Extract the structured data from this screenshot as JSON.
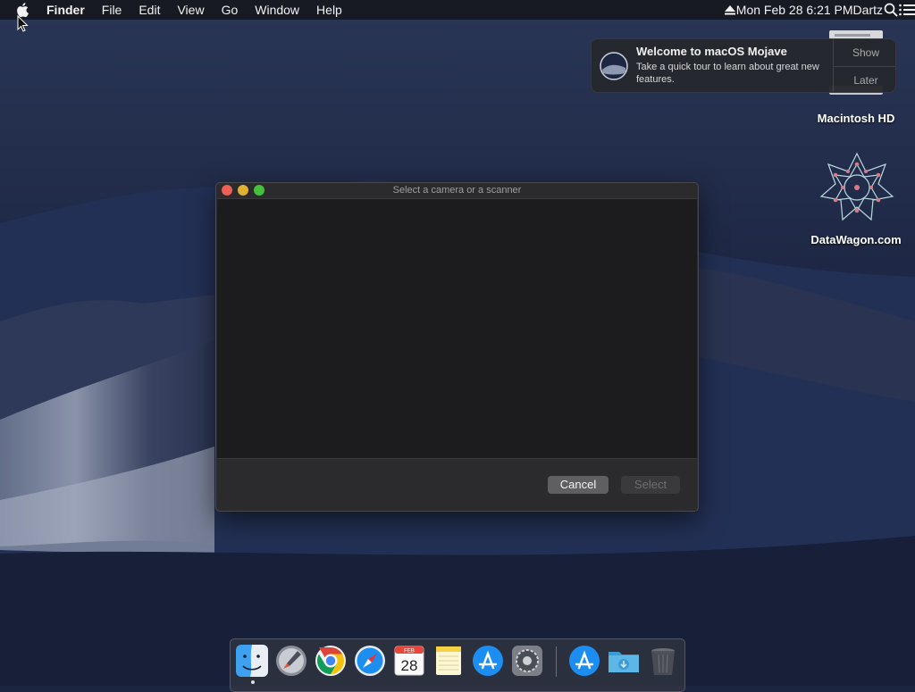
{
  "menubar": {
    "apple_icon": "apple-icon",
    "items": [
      "Finder",
      "File",
      "Edit",
      "View",
      "Go",
      "Window",
      "Help"
    ],
    "clock": "Mon Feb 28  6:21 PM",
    "user": "Dartz"
  },
  "notification": {
    "title": "Welcome to macOS Mojave",
    "body": "Take a quick tour to learn about great new features.",
    "show_label": "Show",
    "later_label": "Later"
  },
  "desktop_icons": [
    {
      "label": "Macintosh HD",
      "icon": "hard-drive-icon"
    },
    {
      "label": "DataWagon.com",
      "icon": "geometric-star-icon"
    }
  ],
  "dialog": {
    "title": "Select a camera or a scanner",
    "cancel_label": "Cancel",
    "select_label": "Select"
  },
  "dock": {
    "items": [
      "finder-icon",
      "launchpad-icon",
      "chrome-icon",
      "safari-icon",
      "calendar-icon",
      "notes-icon",
      "app-store-icon",
      "system-preferences-icon",
      "app-store-download-icon",
      "downloads-folder-icon",
      "trash-icon"
    ],
    "calendar_month": "FEB",
    "calendar_day": "28"
  },
  "colors": {
    "close": "#ed5f57",
    "minimize": "#e0b032",
    "zoom": "#45c03c",
    "app_store_blue": "#1c8ef2",
    "desktop": "#1b2540"
  }
}
